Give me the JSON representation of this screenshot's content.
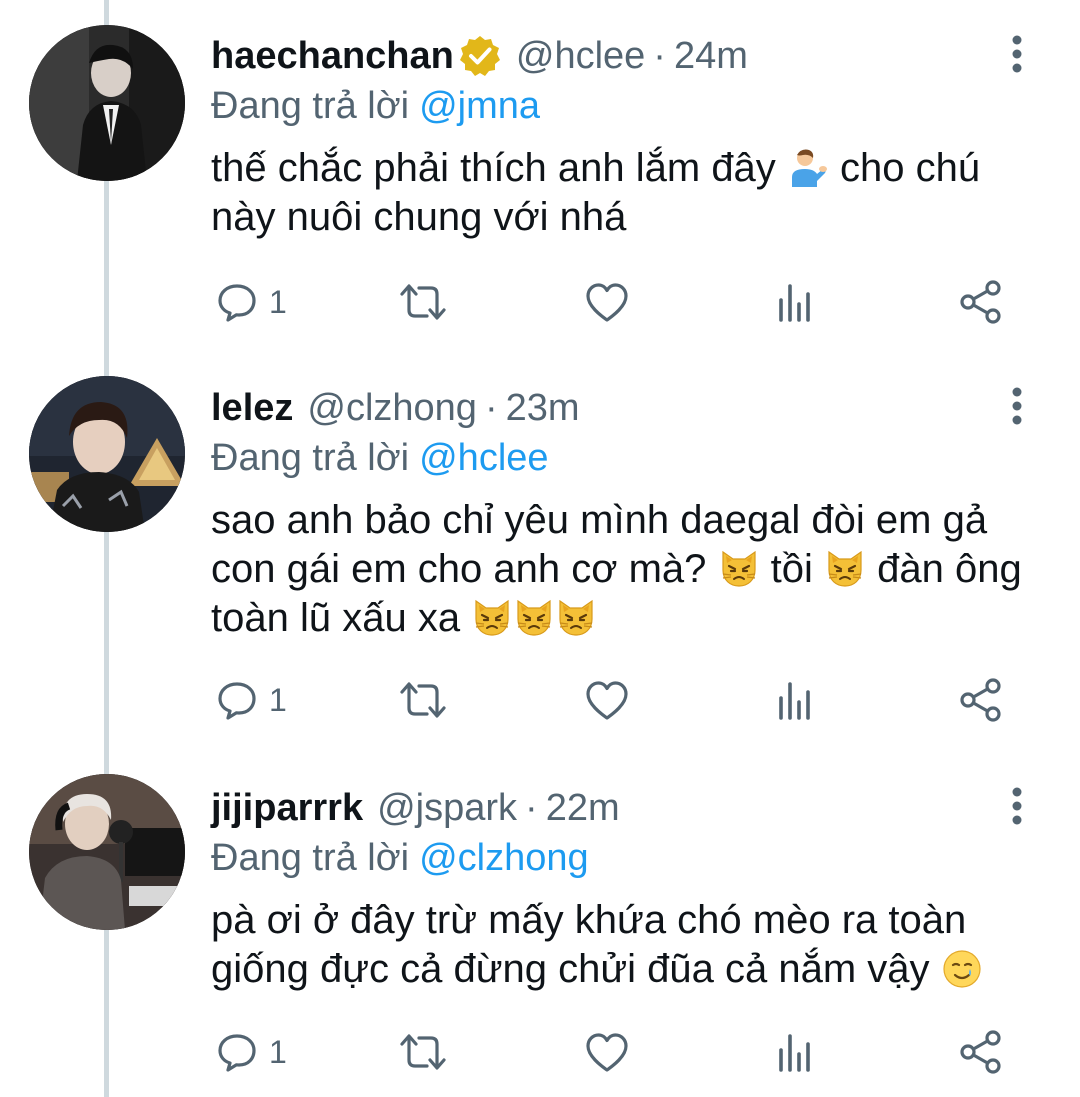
{
  "reply_prefix": "Đang trả lời",
  "tweets": [
    {
      "name": "haechanchan",
      "verified": true,
      "handle": "@hclee",
      "dot": "·",
      "time": "24m",
      "reply_to": "@jmna",
      "text_parts": [
        "thế chắc phải thích anh lắm đây ",
        " cho chú này nuôi chung với nhá"
      ],
      "emojis": [
        "person-tipping-hand-emoji"
      ],
      "reply_count": "1"
    },
    {
      "name": "lelez",
      "verified": false,
      "handle": "@clzhong",
      "dot": "·",
      "time": "23m",
      "reply_to": "@hclee",
      "text_parts": [
        "sao anh bảo chỉ yêu mình daegal đòi em gả con gái em cho anh cơ mà? ",
        " tồi ",
        " đàn ông toàn lũ xấu xa "
      ],
      "emojis": [
        "pouting-cat-emoji",
        "pouting-cat-emoji",
        "pouting-cat-emoji x3"
      ],
      "reply_count": "1"
    },
    {
      "name": "jijiparrrk",
      "verified": false,
      "handle": "@jspark",
      "dot": "·",
      "time": "22m",
      "reply_to": "@clzhong",
      "text_parts": [
        "pà ơi ở đây trừ mấy khứa chó mèo ra toàn giống đực cả đừng chửi đũa cả nắm vậy "
      ],
      "emojis": [
        "smiling-face-with-tear-emoji"
      ],
      "reply_count": "1"
    }
  ],
  "colors": {
    "secondary_text": "#536471",
    "link": "#1d9bf0",
    "thread_line": "#cfd9de",
    "verified_badge": "#e2b719"
  },
  "icons": [
    "reply-icon",
    "retweet-icon",
    "like-icon",
    "analytics-icon",
    "share-icon",
    "more-icon",
    "verified-badge-icon"
  ]
}
